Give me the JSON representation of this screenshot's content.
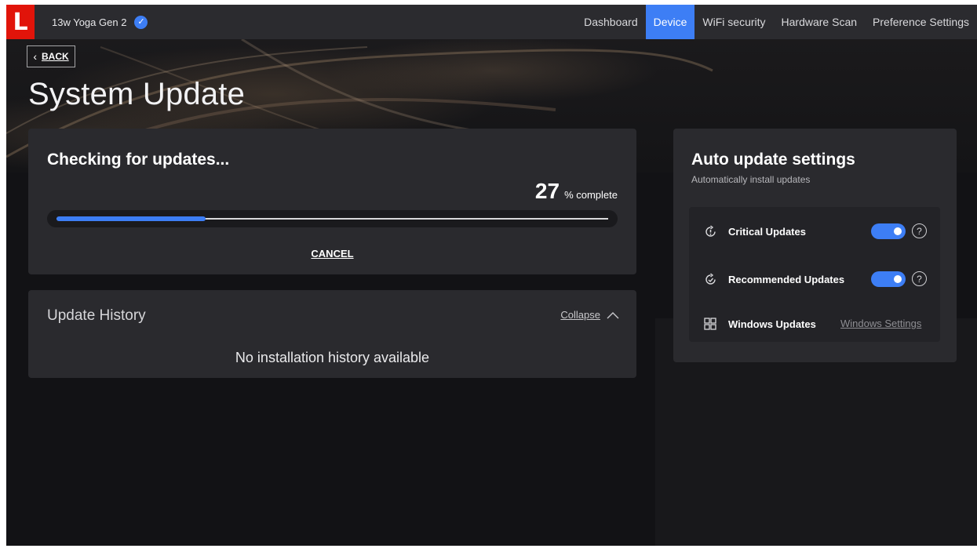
{
  "topbar": {
    "logo": "L",
    "device_name": "13w Yoga Gen 2",
    "nav": [
      "Dashboard",
      "Device",
      "WiFi security",
      "Hardware Scan",
      "Preference Settings"
    ],
    "active_nav": "Device"
  },
  "back": {
    "label": "BACK"
  },
  "page": {
    "title": "System Update"
  },
  "check": {
    "heading": "Checking for updates...",
    "percent": "27",
    "percent_suffix": "% complete",
    "progress": 0.27,
    "cancel": "CANCEL"
  },
  "history": {
    "heading": "Update History",
    "collapse": "Collapse",
    "empty": "No installation history available"
  },
  "auto": {
    "heading": "Auto update settings",
    "subheading": "Automatically install updates",
    "critical": {
      "label": "Critical Updates",
      "enabled": true
    },
    "recommended": {
      "label": "Recommended Updates",
      "enabled": true
    },
    "windows": {
      "label": "Windows Updates",
      "link": "Windows Settings"
    }
  },
  "colors": {
    "accent": "#3d7ef5",
    "brand": "#e1140a"
  }
}
